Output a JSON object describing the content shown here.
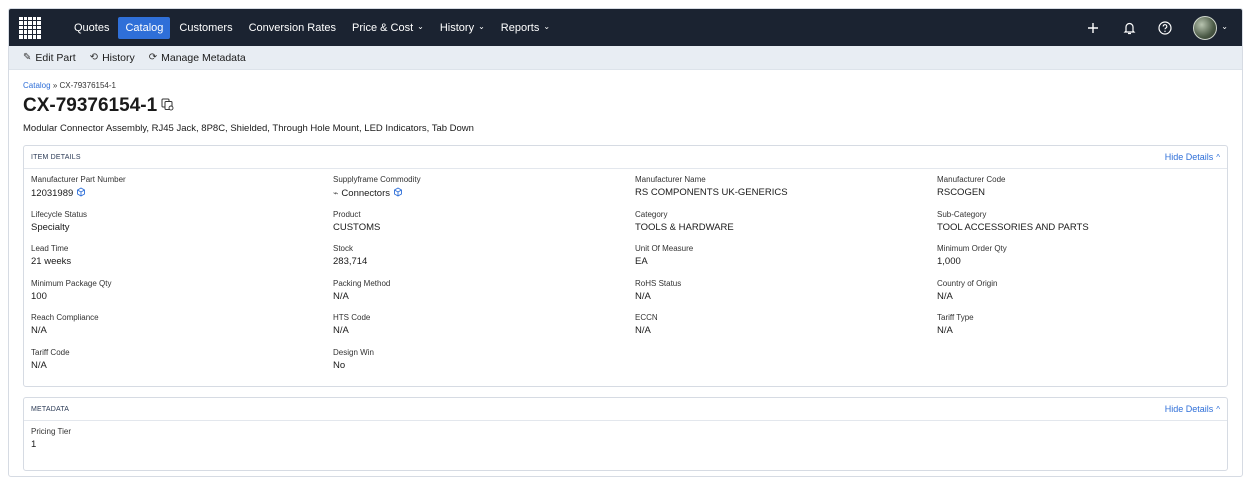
{
  "nav": {
    "items": [
      {
        "label": "Quotes",
        "dropdown": false,
        "active": false
      },
      {
        "label": "Catalog",
        "dropdown": false,
        "active": true
      },
      {
        "label": "Customers",
        "dropdown": false,
        "active": false
      },
      {
        "label": "Conversion Rates",
        "dropdown": false,
        "active": false
      },
      {
        "label": "Price & Cost",
        "dropdown": true,
        "active": false
      },
      {
        "label": "History",
        "dropdown": true,
        "active": false
      },
      {
        "label": "Reports",
        "dropdown": true,
        "active": false
      }
    ],
    "icons": {
      "add": "plus-icon",
      "notifications": "bell-icon",
      "help": "help-icon",
      "user": "avatar"
    }
  },
  "toolbar": {
    "edit_label": "Edit Part",
    "history_label": "History",
    "metadata_label": "Manage Metadata"
  },
  "breadcrumb": {
    "root": "Catalog",
    "separator": "»",
    "current": "CX-79376154-1"
  },
  "part": {
    "number": "CX-79376154-1",
    "description": "Modular Connector Assembly, RJ45 Jack, 8P8C, Shielded, Through Hole Mount, LED Indicators, Tab Down"
  },
  "item_details": {
    "title": "ITEM DETAILS",
    "hide_label": "Hide Details",
    "fields": [
      {
        "label": "Manufacturer Part Number",
        "value": "12031989",
        "icon": "cube-icon"
      },
      {
        "label": "Supplyframe Commodity",
        "value": "Connectors",
        "icon": "cube-icon",
        "prefix_icon": "link-icon"
      },
      {
        "label": "Manufacturer Name",
        "value": "RS COMPONENTS UK-GENERICS"
      },
      {
        "label": "Manufacturer Code",
        "value": "RSCOGEN"
      },
      {
        "label": "Lifecycle Status",
        "value": "Specialty"
      },
      {
        "label": "Product",
        "value": "CUSTOMS"
      },
      {
        "label": "Category",
        "value": "TOOLS & HARDWARE"
      },
      {
        "label": "Sub-Category",
        "value": "TOOL ACCESSORIES AND PARTS"
      },
      {
        "label": "Lead Time",
        "value": "21 weeks"
      },
      {
        "label": "Stock",
        "value": "283,714"
      },
      {
        "label": "Unit Of Measure",
        "value": "EA"
      },
      {
        "label": "Minimum Order Qty",
        "value": "1,000"
      },
      {
        "label": "Minimum Package Qty",
        "value": "100"
      },
      {
        "label": "Packing Method",
        "value": "N/A"
      },
      {
        "label": "RoHS Status",
        "value": "N/A"
      },
      {
        "label": "Country of Origin",
        "value": "N/A"
      },
      {
        "label": "Reach Compliance",
        "value": "N/A"
      },
      {
        "label": "HTS Code",
        "value": "N/A"
      },
      {
        "label": "ECCN",
        "value": "N/A"
      },
      {
        "label": "Tariff Type",
        "value": "N/A"
      },
      {
        "label": "Tariff Code",
        "value": "N/A"
      },
      {
        "label": "Design Win",
        "value": "No"
      }
    ]
  },
  "metadata": {
    "title": "METADATA",
    "hide_label": "Hide Details",
    "fields": [
      {
        "label": "Pricing Tier",
        "value": "1"
      }
    ]
  },
  "colors": {
    "nav_bg": "#1b2331",
    "accent": "#2f6fd8",
    "toolbar_bg": "#e8edf3"
  }
}
